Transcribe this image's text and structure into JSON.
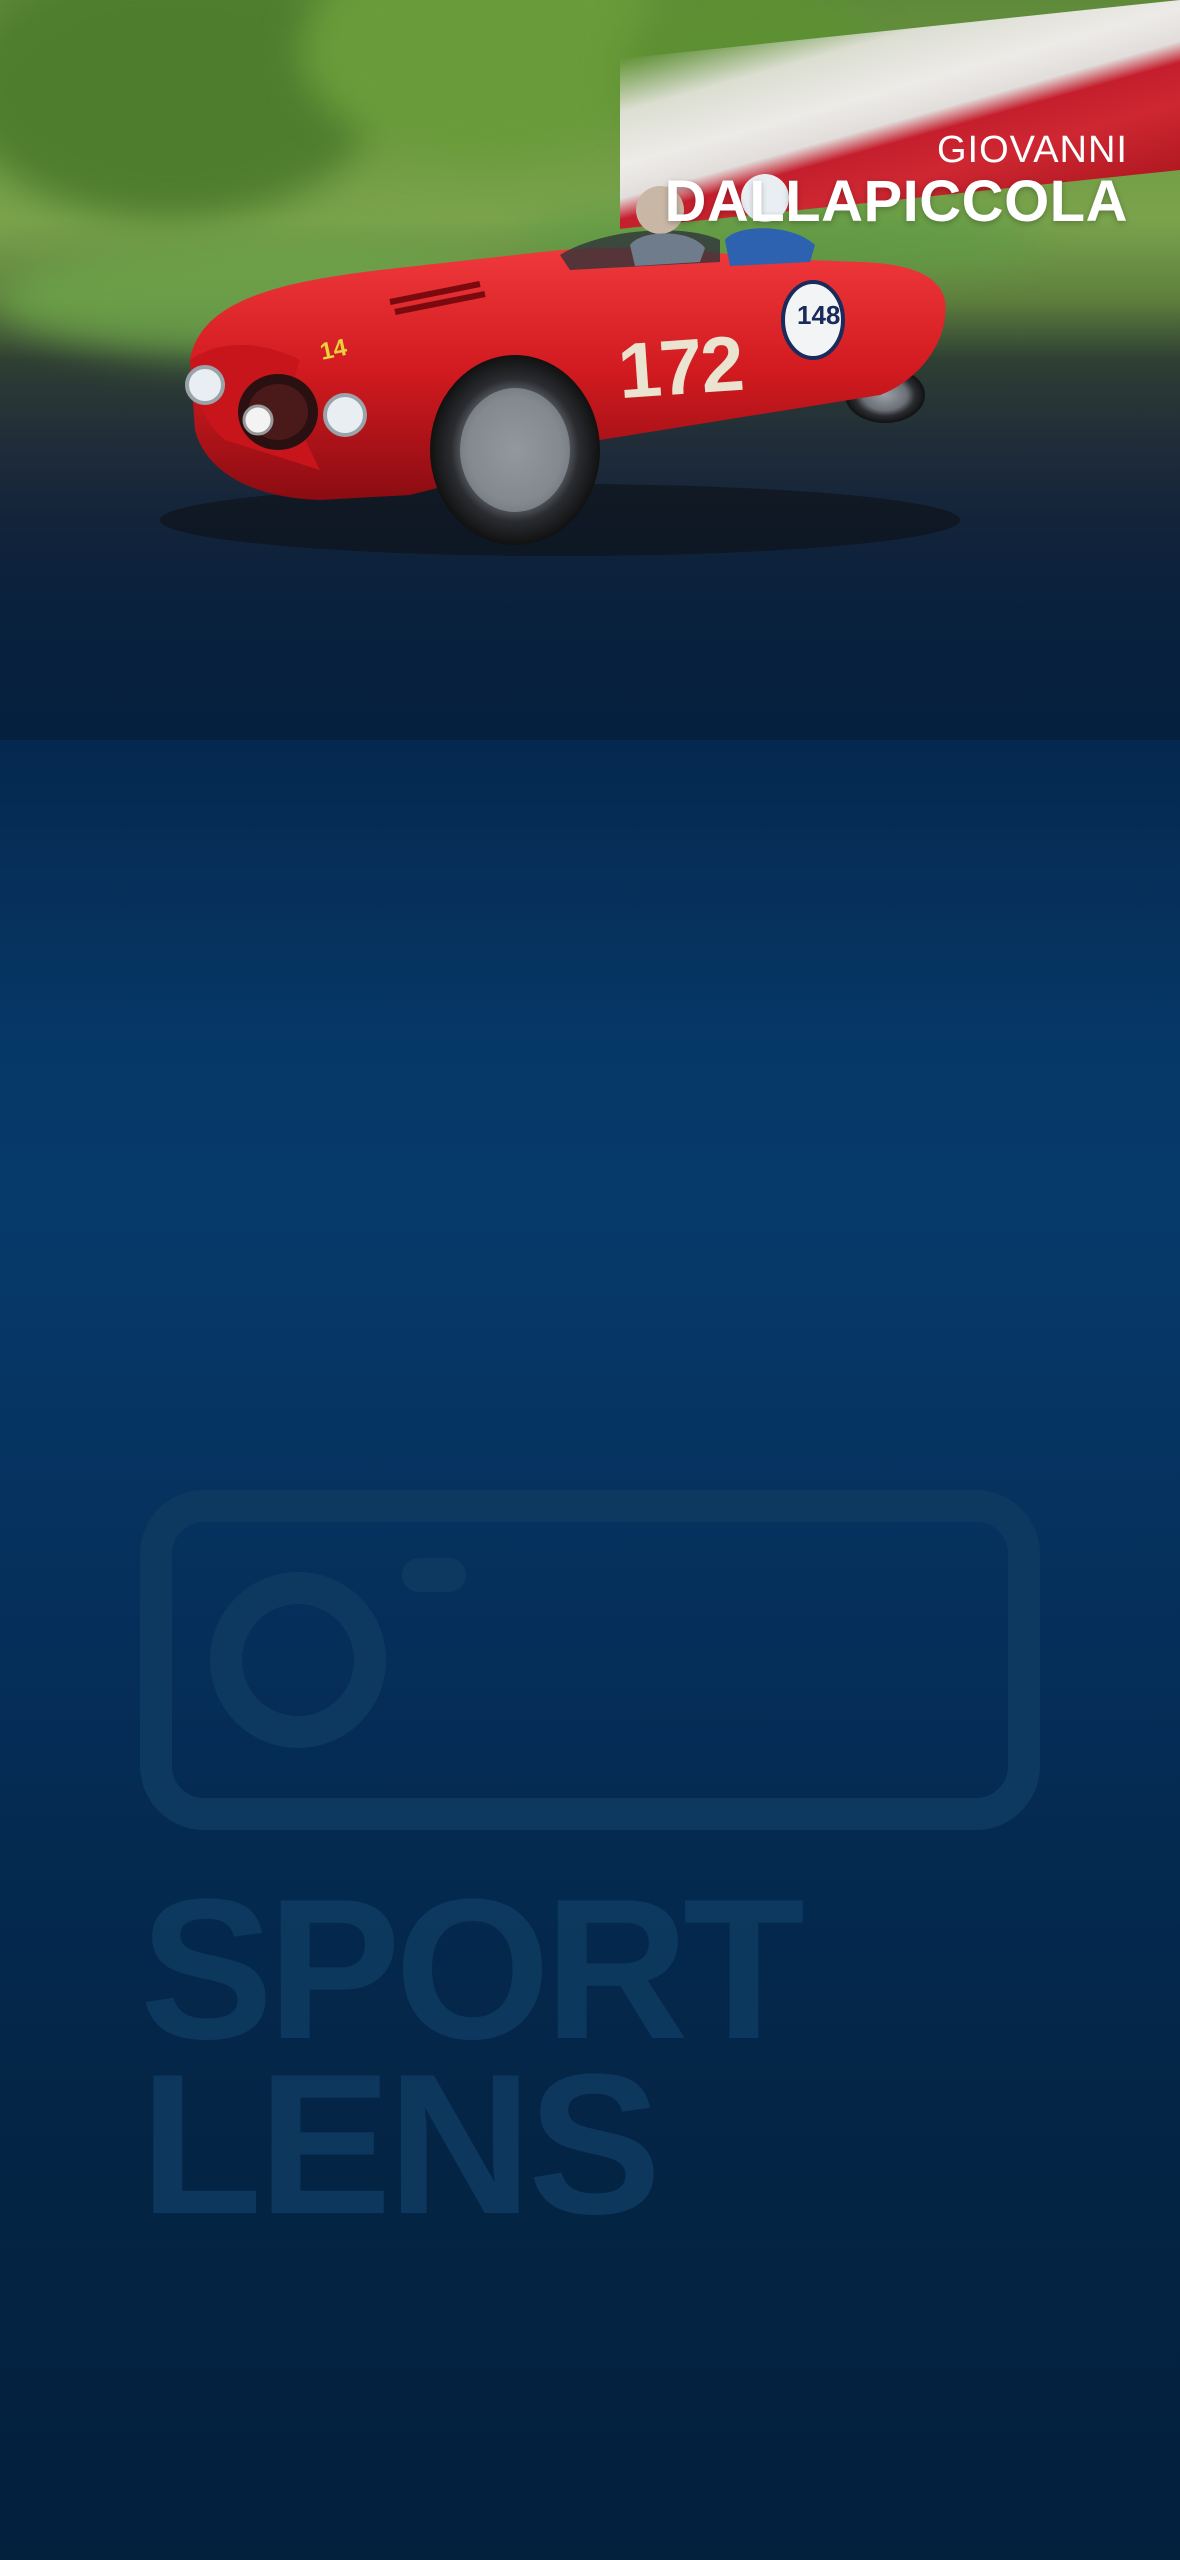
{
  "driver": {
    "first_name": "GIOVANNI",
    "last_name": "DALLAPICCOLA"
  },
  "photo": {
    "car_number": "172",
    "plate_number": "148"
  },
  "watermark": {
    "line1": "SPORT",
    "line2": "LENS",
    "icon": "camera-icon"
  },
  "colors": {
    "background_top": "#05203f",
    "background_mid": "#063a6b",
    "background_bottom": "#03203d",
    "car_red": "#d01a1f",
    "flag_red": "#c9182c",
    "flag_white": "#f4f0f1",
    "watermark": "#0f3b62"
  }
}
